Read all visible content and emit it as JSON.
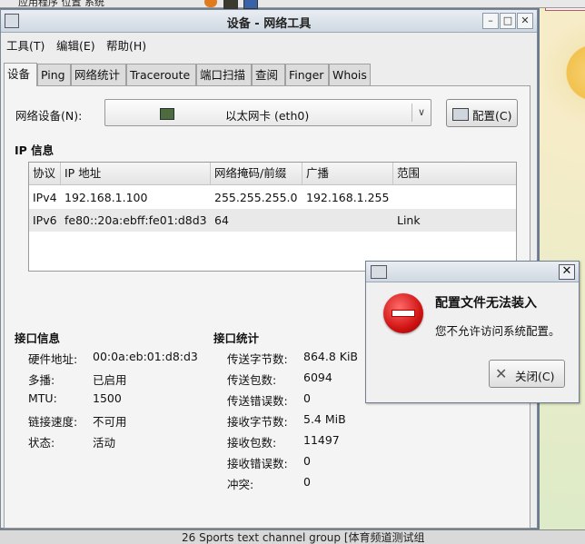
{
  "desktop": {
    "top_text": "应用程序 位置 系统",
    "bottom_text": "26 Sports text channel group [体育频道测试组"
  },
  "window": {
    "title": "设备 - 网络工具",
    "min_glyph": "–",
    "max_glyph": "□",
    "close_glyph": "✕"
  },
  "menu": [
    "工具(T)",
    "编辑(E)",
    "帮助(H)"
  ],
  "tabs": [
    "设备",
    "Ping",
    "网络统计",
    "Traceroute",
    "端口扫描",
    "查阅",
    "Finger",
    "Whois"
  ],
  "device": {
    "label": "网络设备(N):",
    "selected": "以太网卡 (eth0)",
    "dropdown_glyph": "∨",
    "config_button": "配置(C)"
  },
  "ip_section": {
    "title": "IP 信息",
    "columns": [
      "协议",
      "IP 地址",
      "网络掩码/前缀",
      "广播",
      "范围"
    ],
    "rows": [
      [
        "IPv4",
        "192.168.1.100",
        "255.255.255.0",
        "192.168.1.255",
        ""
      ],
      [
        "IPv6",
        "fe80::20a:ebff:fe01:d8d3",
        "64",
        "",
        "Link"
      ]
    ]
  },
  "iface_info": {
    "title": "接口信息",
    "items": [
      {
        "label": "硬件地址:",
        "value": "00:0a:eb:01:d8:d3"
      },
      {
        "label": "多播:",
        "value": "已启用"
      },
      {
        "label": "MTU:",
        "value": "1500"
      },
      {
        "label": "链接速度:",
        "value": "不可用"
      },
      {
        "label": "状态:",
        "value": "活动"
      }
    ]
  },
  "iface_stats": {
    "title": "接口统计",
    "items": [
      {
        "label": "传送字节数:",
        "value": "864.8 KiB"
      },
      {
        "label": "传送包数:",
        "value": "6094"
      },
      {
        "label": "传送错误数:",
        "value": "0"
      },
      {
        "label": "接收字节数:",
        "value": "5.4 MiB"
      },
      {
        "label": "接收包数:",
        "value": "11497"
      },
      {
        "label": "接收错误数:",
        "value": "0"
      },
      {
        "label": "冲突:",
        "value": "0"
      }
    ]
  },
  "dialog": {
    "close_glyph": "✕",
    "heading": "配置文件无法装入",
    "message": "您不允许访问系统配置。",
    "close_button": "关闭(C)",
    "button_icon_glyph": "✕"
  }
}
